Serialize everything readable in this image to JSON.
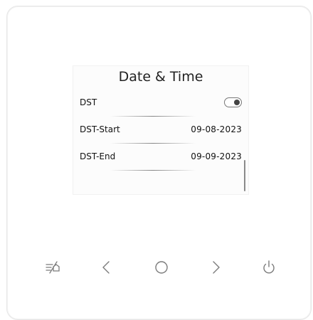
{
  "screen": {
    "title": "Date & Time",
    "rows": [
      {
        "label": "DST",
        "type": "toggle",
        "toggle_on": true
      },
      {
        "label": "DST-Start",
        "value": "09-08-2023"
      },
      {
        "label": "DST-End",
        "value": "09-09-2023"
      }
    ]
  },
  "buttons": {
    "menu_icon": "menu-toggle-icon",
    "left_icon": "chevron-left-icon",
    "home_icon": "circle-home-icon",
    "right_icon": "chevron-right-icon",
    "power_icon": "power-icon"
  },
  "colors": {
    "icon": "#7b7b7b",
    "text": "#111111",
    "background": "#ffffff"
  }
}
